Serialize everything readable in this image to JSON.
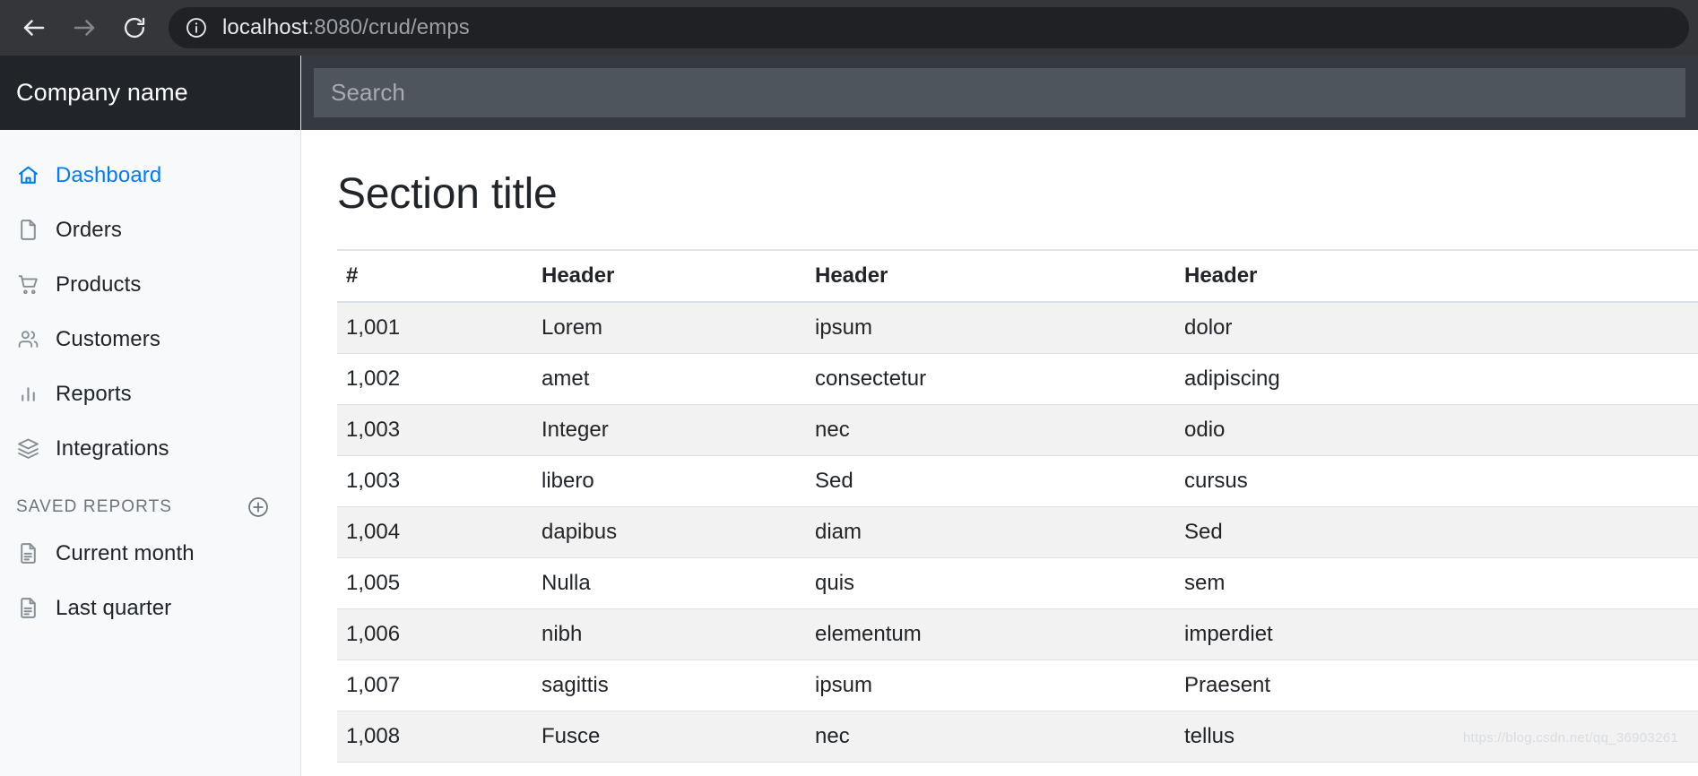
{
  "browser": {
    "back_icon": "arrow-left-icon",
    "forward_icon": "arrow-right-icon",
    "reload_icon": "reload-icon",
    "info_icon": "info-circle-icon",
    "url_host": "localhost",
    "url_path": ":8080/crud/emps",
    "url_full": "localhost:8080/crud/emps"
  },
  "sidebar": {
    "brand": "Company name",
    "items": [
      {
        "label": "Dashboard",
        "icon": "home-icon",
        "active": true
      },
      {
        "label": "Orders",
        "icon": "file-icon",
        "active": false
      },
      {
        "label": "Products",
        "icon": "cart-icon",
        "active": false
      },
      {
        "label": "Customers",
        "icon": "users-icon",
        "active": false
      },
      {
        "label": "Reports",
        "icon": "bar-chart-icon",
        "active": false
      },
      {
        "label": "Integrations",
        "icon": "layers-icon",
        "active": false
      }
    ],
    "saved_reports": {
      "title": "SAVED REPORTS",
      "add_icon": "plus-circle-icon",
      "items": [
        {
          "label": "Current month",
          "icon": "file-text-icon"
        },
        {
          "label": "Last quarter",
          "icon": "file-text-icon"
        }
      ]
    }
  },
  "navbar": {
    "search_placeholder": "Search",
    "search_value": ""
  },
  "main": {
    "title": "Section title",
    "table": {
      "columns": [
        "#",
        "Header",
        "Header",
        "Header"
      ],
      "rows": [
        [
          "1,001",
          "Lorem",
          "ipsum",
          "dolor"
        ],
        [
          "1,002",
          "amet",
          "consectetur",
          "adipiscing"
        ],
        [
          "1,003",
          "Integer",
          "nec",
          "odio"
        ],
        [
          "1,003",
          "libero",
          "Sed",
          "cursus"
        ],
        [
          "1,004",
          "dapibus",
          "diam",
          "Sed"
        ],
        [
          "1,005",
          "Nulla",
          "quis",
          "sem"
        ],
        [
          "1,006",
          "nibh",
          "elementum",
          "imperdiet"
        ],
        [
          "1,007",
          "sagittis",
          "ipsum",
          "Praesent"
        ],
        [
          "1,008",
          "Fusce",
          "nec",
          "tellus"
        ]
      ]
    }
  },
  "watermark": "https://blog.csdn.net/qq_36903261",
  "colors": {
    "accent": "#007bff",
    "brand_bg": "#212529",
    "navbar_bg": "#343a40",
    "search_bg": "#4f565b",
    "sidebar_bg": "#f8f9fa",
    "stripe": "#f2f2f2",
    "browser_bg": "#35363a",
    "url_pill_bg": "#202124"
  }
}
